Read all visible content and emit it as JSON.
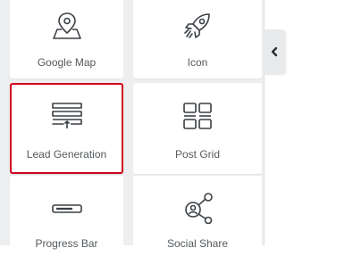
{
  "widgets": [
    {
      "label": "Google Map",
      "icon": "map-pin-icon"
    },
    {
      "label": "Icon",
      "icon": "rocket-icon"
    },
    {
      "label": "Lead Generation",
      "icon": "lead-form-icon",
      "selected": true
    },
    {
      "label": "Post Grid",
      "icon": "grid-icon"
    },
    {
      "label": "Progress Bar",
      "icon": "progress-bar-icon"
    },
    {
      "label": "Social Share",
      "icon": "share-icon"
    }
  ],
  "collapse_tab": {
    "icon": "chevron-left-icon"
  },
  "colors": {
    "selection": "#d0021b",
    "icon": "#3a3f44",
    "label": "#555a5e",
    "panel": "#eceeef"
  }
}
